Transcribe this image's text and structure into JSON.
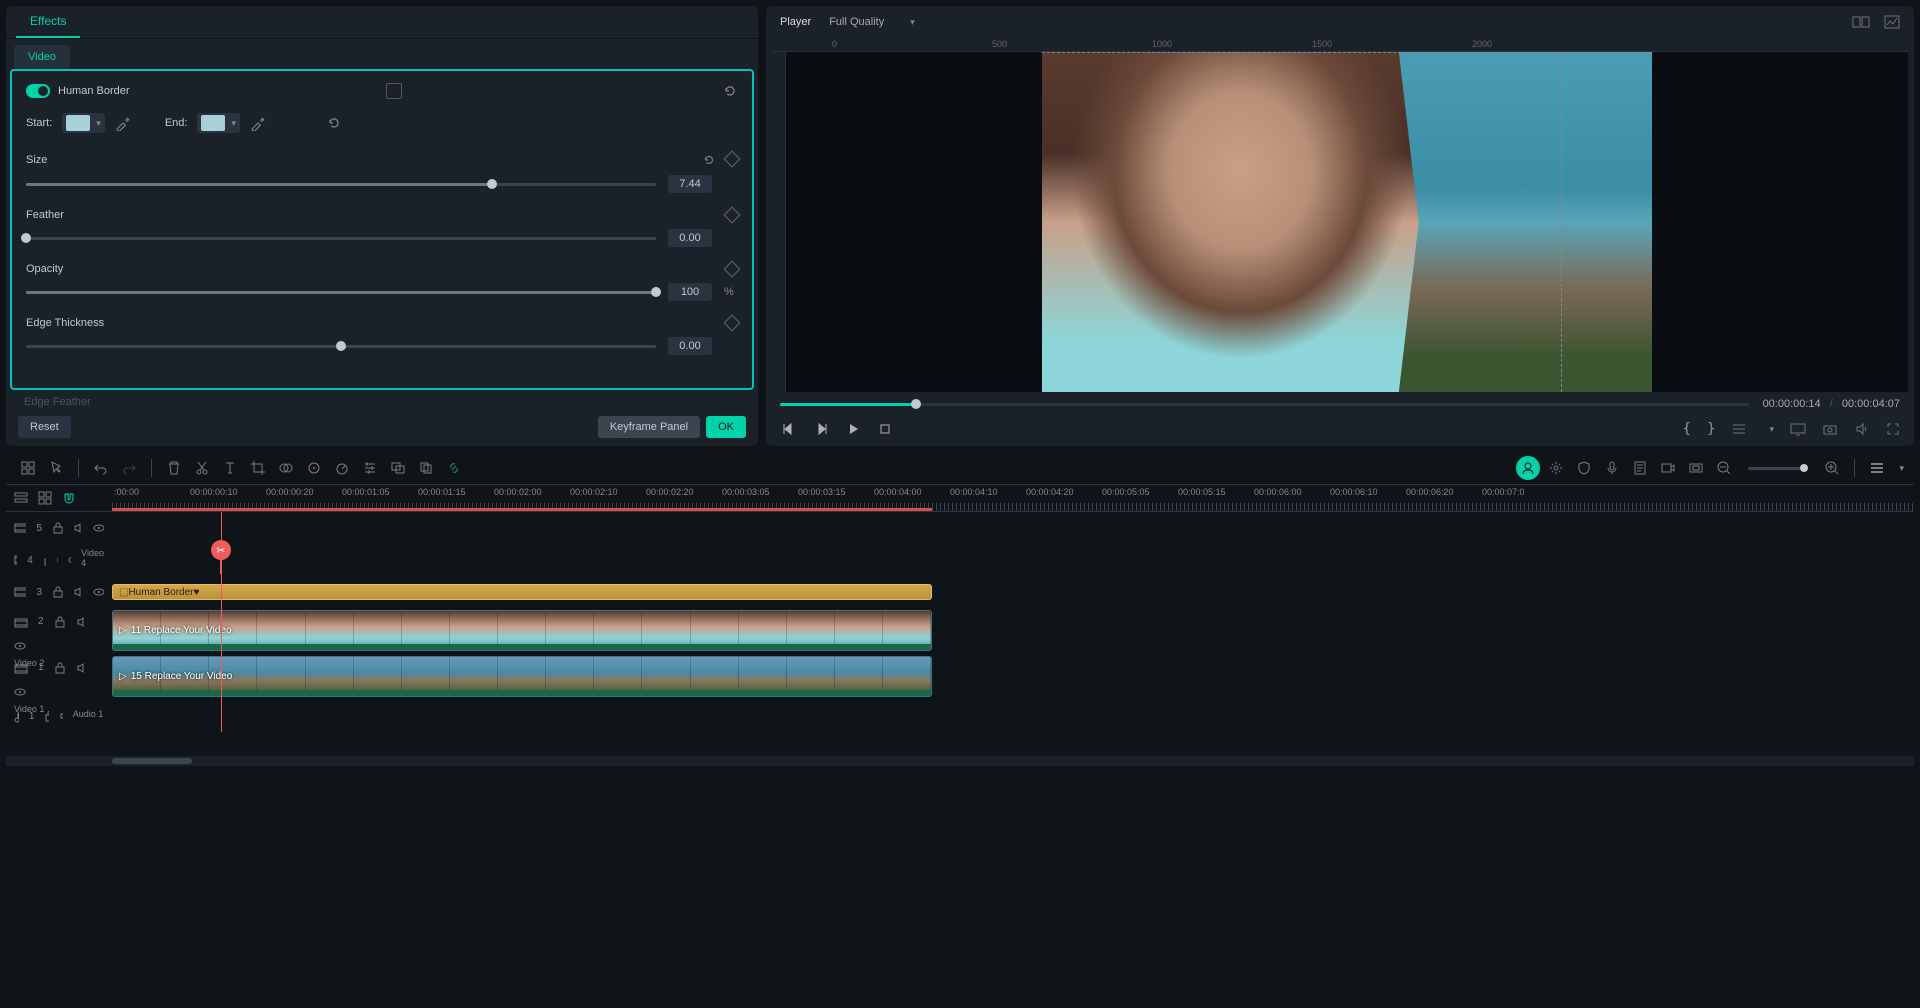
{
  "effects": {
    "tab_label": "Effects",
    "subtab_label": "Video",
    "effect_name": "Human Border",
    "start_label": "Start:",
    "end_label": "End:",
    "sliders": {
      "size": {
        "label": "Size",
        "value": "7.44",
        "position": 74
      },
      "feather": {
        "label": "Feather",
        "value": "0.00",
        "position": 0
      },
      "opacity": {
        "label": "Opacity",
        "value": "100",
        "unit": "%",
        "position": 100
      },
      "edge_thickness": {
        "label": "Edge Thickness",
        "value": "0.00",
        "position": 50
      }
    },
    "edge_feather_label": "Edge Feather",
    "reset_btn": "Reset",
    "keyframe_btn": "Keyframe Panel",
    "ok_btn": "OK"
  },
  "player": {
    "title": "Player",
    "quality": "Full Quality",
    "ruler_marks": [
      "0",
      "500",
      "1000",
      "1500",
      "2000"
    ],
    "time_current": "00:00:00:14",
    "time_total": "00:00:04:07",
    "time_sep": "/"
  },
  "timeline": {
    "ruler": [
      ":00:00",
      "00:00:00:10",
      "00:00:00:20",
      "00:00:01:05",
      "00:00:01:15",
      "00:00:02:00",
      "00:00:02:10",
      "00:00:02:20",
      "00:00:03:05",
      "00:00:03:15",
      "00:00:04:00",
      "00:00:04:10",
      "00:00:04:20",
      "00:00:05:05",
      "00:00:05:15",
      "00:00:06:00",
      "00:00:06:10",
      "00:00:06:20",
      "00:00:07:0"
    ],
    "tracks": [
      {
        "icon": "video",
        "num": "5",
        "label": ""
      },
      {
        "icon": "video",
        "num": "4",
        "label": "Video 4"
      },
      {
        "icon": "video",
        "num": "3",
        "label": ""
      },
      {
        "icon": "video",
        "num": "2",
        "label": "Video 2"
      },
      {
        "icon": "video",
        "num": "1",
        "label": "Video 1"
      },
      {
        "icon": "audio",
        "num": "1",
        "label": "Audio 1"
      }
    ],
    "clip_effect": "Human Border",
    "clip_video2": "11 Replace Your Video",
    "clip_video1": "15 Replace Your Video"
  }
}
